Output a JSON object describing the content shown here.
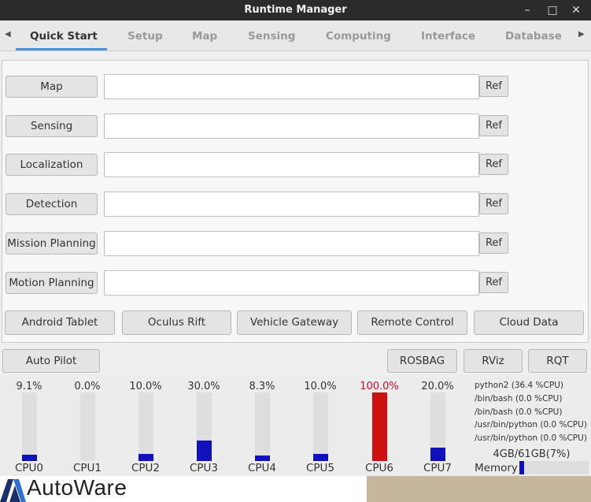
{
  "window": {
    "title": "Runtime Manager"
  },
  "tabs": [
    {
      "label": "Quick Start",
      "active": true
    },
    {
      "label": "Setup"
    },
    {
      "label": "Map"
    },
    {
      "label": "Sensing"
    },
    {
      "label": "Computing"
    },
    {
      "label": "Interface"
    },
    {
      "label": "Database"
    }
  ],
  "rows": [
    {
      "label": "Map",
      "value": "",
      "ref": "Ref"
    },
    {
      "label": "Sensing",
      "value": "",
      "ref": "Ref"
    },
    {
      "label": "Localization",
      "value": "",
      "ref": "Ref"
    },
    {
      "label": "Detection",
      "value": "",
      "ref": "Ref"
    },
    {
      "label": "Mission Planning",
      "value": "",
      "ref": "Ref"
    },
    {
      "label": "Motion Planning",
      "value": "",
      "ref": "Ref"
    }
  ],
  "buttons": {
    "android_tablet": "Android Tablet",
    "oculus_rift": "Oculus Rift",
    "vehicle_gateway": "Vehicle Gateway",
    "remote_control": "Remote Control",
    "cloud_data": "Cloud Data",
    "auto_pilot": "Auto Pilot",
    "rosbag": "ROSBAG",
    "rviz": "RViz",
    "rqt": "RQT"
  },
  "cpus": [
    {
      "name": "CPU0",
      "pct_text": "9.1%",
      "pct": 9.1,
      "color": "#1111bb"
    },
    {
      "name": "CPU1",
      "pct_text": "0.0%",
      "pct": 0.0,
      "color": "#1111bb"
    },
    {
      "name": "CPU2",
      "pct_text": "10.0%",
      "pct": 10.0,
      "color": "#1111bb"
    },
    {
      "name": "CPU3",
      "pct_text": "30.0%",
      "pct": 30.0,
      "color": "#1111bb"
    },
    {
      "name": "CPU4",
      "pct_text": "8.3%",
      "pct": 8.3,
      "color": "#1111bb"
    },
    {
      "name": "CPU5",
      "pct_text": "10.0%",
      "pct": 10.0,
      "color": "#1111bb"
    },
    {
      "name": "CPU6",
      "pct_text": "100.0%",
      "pct": 100.0,
      "color": "#cc1111",
      "alert": true
    },
    {
      "name": "CPU7",
      "pct_text": "20.0%",
      "pct": 20.0,
      "color": "#1111bb"
    }
  ],
  "processes": [
    "python2 (36.4 %CPU)",
    "/bin/bash (0.0 %CPU)",
    "/bin/bash (0.0 %CPU)",
    "/usr/bin/python (0.0 %CPU)",
    "/usr/bin/python (0.0 %CPU)"
  ],
  "memory": {
    "text": "4GB/61GB(7%)",
    "label": "Memory",
    "pct": 7,
    "color": "#1111bb"
  },
  "logo": {
    "text": "AutoWare"
  },
  "colors": {
    "accent": "#4a90d9",
    "alert": "#cc1111",
    "bar": "#1111bb"
  }
}
